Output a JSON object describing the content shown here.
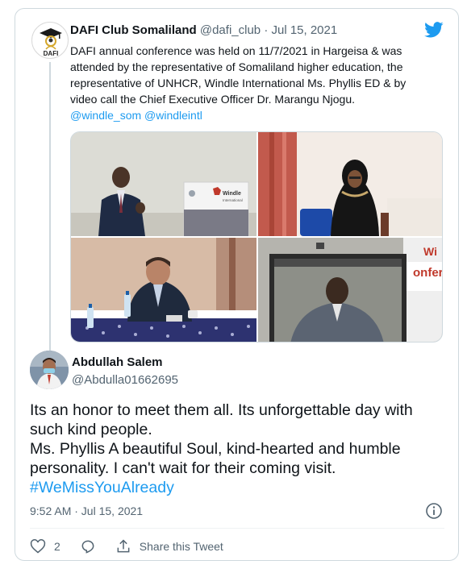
{
  "parent_tweet": {
    "author_name": "DAFI Club Somaliland",
    "author_handle": "@dafi_club",
    "date": "· Jul 15, 2021",
    "avatar_label": "DAFI",
    "lines": [
      "DAFI annual conference was held on 11/7/2021 in Hargeisa & was",
      "attended by the representative of Somaliland higher education, the",
      "representative of UNHCR, Windle International Ms. Phyllis ED & by",
      "video call the Chief Executive Officer  Dr. Marangu Njogu."
    ],
    "mentions": "@windle_som @windleintl",
    "photo_banner_text": "Windle",
    "photo_banner_sub": "International",
    "screen_text": "onferen",
    "screen_corner": "Wi"
  },
  "tweet": {
    "author_name": "Abdullah Salem",
    "author_handle": "@Abdulla01662695",
    "lines": [
      "Its an honor to meet them all. Its unforgettable day with",
      "such kind people.",
      "Ms. Phyllis A beautiful Soul, kind-hearted and humble",
      "personality. I can't wait for their coming visit."
    ],
    "hashtag": "#WeMissYouAlready",
    "timestamp": "9:52 AM · Jul 15, 2021",
    "like_count": "2",
    "share_label": "Share this Tweet"
  },
  "colors": {
    "accent": "#1d9bf0",
    "text": "#0f1419",
    "muted": "#536471"
  },
  "icons": [
    "twitter-bird-icon",
    "info-icon",
    "heart-icon",
    "reply-icon",
    "share-icon"
  ]
}
